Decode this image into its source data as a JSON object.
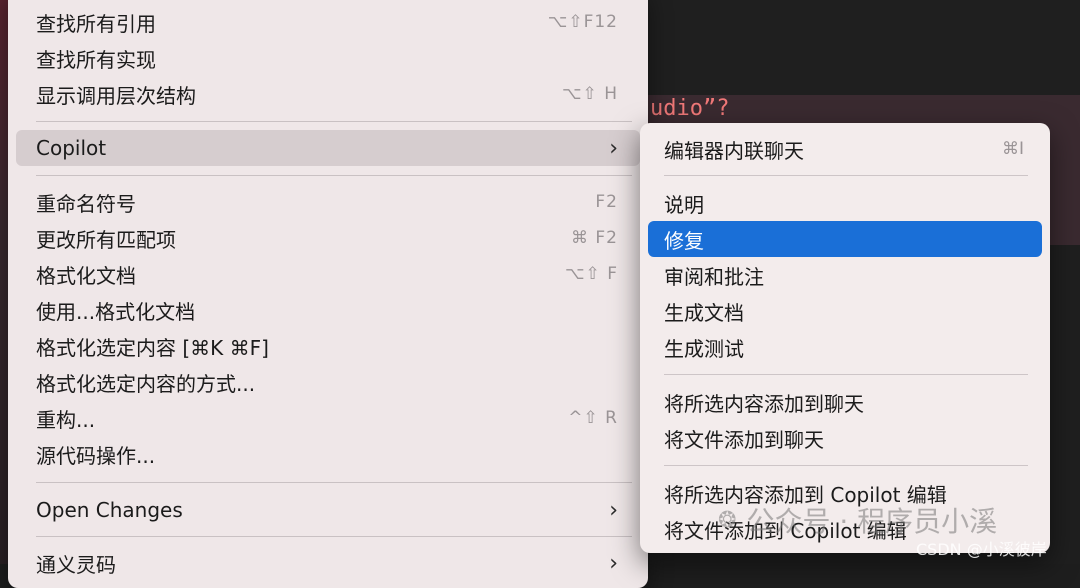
{
  "editor": {
    "code_snippet": "udio”?"
  },
  "menu": {
    "items": [
      {
        "label": "查找所有引用",
        "shortcut": "⌥⇧F12"
      },
      {
        "label": "查找所有实现",
        "shortcut": ""
      },
      {
        "label": "显示调用层次结构",
        "shortcut": "⌥⇧ H"
      },
      {
        "label": "Copilot",
        "shortcut": ""
      },
      {
        "label": "重命名符号",
        "shortcut": "F2"
      },
      {
        "label": "更改所有匹配项",
        "shortcut": "⌘ F2"
      },
      {
        "label": "格式化文档",
        "shortcut": "⌥⇧ F"
      },
      {
        "label": "使用...格式化文档",
        "shortcut": ""
      },
      {
        "label": "格式化选定内容 [⌘K ⌘F]",
        "shortcut": ""
      },
      {
        "label": "格式化选定内容的方式...",
        "shortcut": ""
      },
      {
        "label": "重构...",
        "shortcut": "^⇧ R"
      },
      {
        "label": "源代码操作...",
        "shortcut": ""
      },
      {
        "label": "Open Changes",
        "shortcut": ""
      },
      {
        "label": "通义灵码",
        "shortcut": ""
      }
    ],
    "chevron": "›"
  },
  "submenu": {
    "items": [
      {
        "label": "编辑器内联聊天",
        "shortcut": "⌘I"
      },
      {
        "label": "说明",
        "shortcut": ""
      },
      {
        "label": "修复",
        "shortcut": ""
      },
      {
        "label": "审阅和批注",
        "shortcut": ""
      },
      {
        "label": "生成文档",
        "shortcut": ""
      },
      {
        "label": "生成测试",
        "shortcut": ""
      },
      {
        "label": "将所选内容添加到聊天",
        "shortcut": ""
      },
      {
        "label": "将文件添加到聊天",
        "shortcut": ""
      },
      {
        "label": "将所选内容添加到 Copilot 编辑",
        "shortcut": ""
      },
      {
        "label": "将文件添加到 Copilot 编辑",
        "shortcut": ""
      }
    ],
    "selected_index": 2,
    "selected_color": "#1a6fd7"
  },
  "watermark": {
    "text": "公众号 · 程序员小溪",
    "icon": "wechat-icon",
    "csdn": "CSDN @小溪彼岸"
  }
}
